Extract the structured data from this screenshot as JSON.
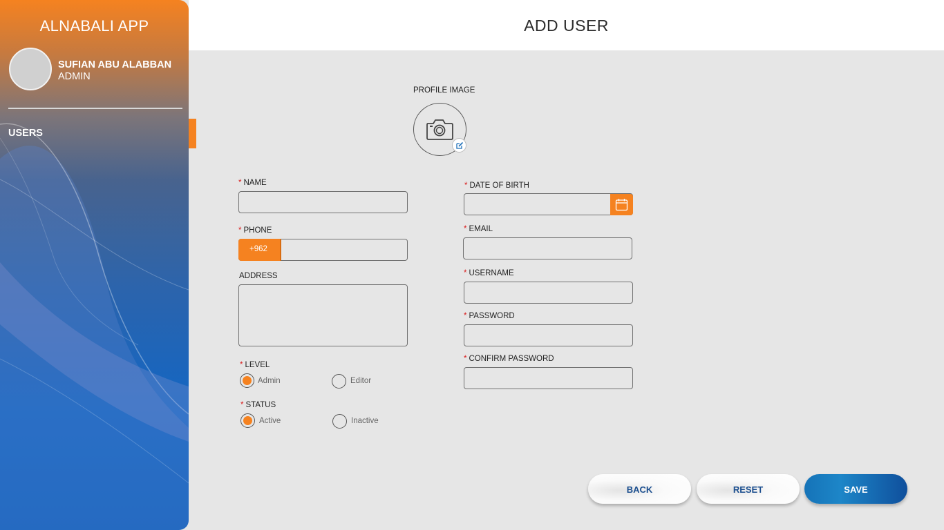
{
  "sidebar": {
    "app_title": "ALNABALI APP",
    "user_name": "SUFIAN ABU ALABBAN",
    "user_role": "ADMIN",
    "nav": [
      {
        "label": "USERS",
        "active": true
      }
    ]
  },
  "header": {
    "title": "ADD USER"
  },
  "form": {
    "profile_image_label": "PROFILE IMAGE",
    "name_label": "NAME",
    "phone_label": "PHONE",
    "phone_prefix": "+962",
    "address_label": "ADDRESS",
    "level_label": "LEVEL",
    "level_options": [
      "Admin",
      "Editor"
    ],
    "level_selected": "Admin",
    "status_label": "STATUS",
    "status_options": [
      "Active",
      "Inactive"
    ],
    "status_selected": "Active",
    "dob_label": "DATE OF BIRTH",
    "email_label": "EMAIL",
    "username_label": "USERNAME",
    "password_label": "PASSWORD",
    "confirm_password_label": "CONFIRM PASSWORD",
    "required_marker": "*"
  },
  "buttons": {
    "back": "BACK",
    "reset": "RESET",
    "save": "SAVE"
  },
  "colors": {
    "accent": "#f58220",
    "primary": "#0f5aa8",
    "required": "#d91c1c"
  }
}
